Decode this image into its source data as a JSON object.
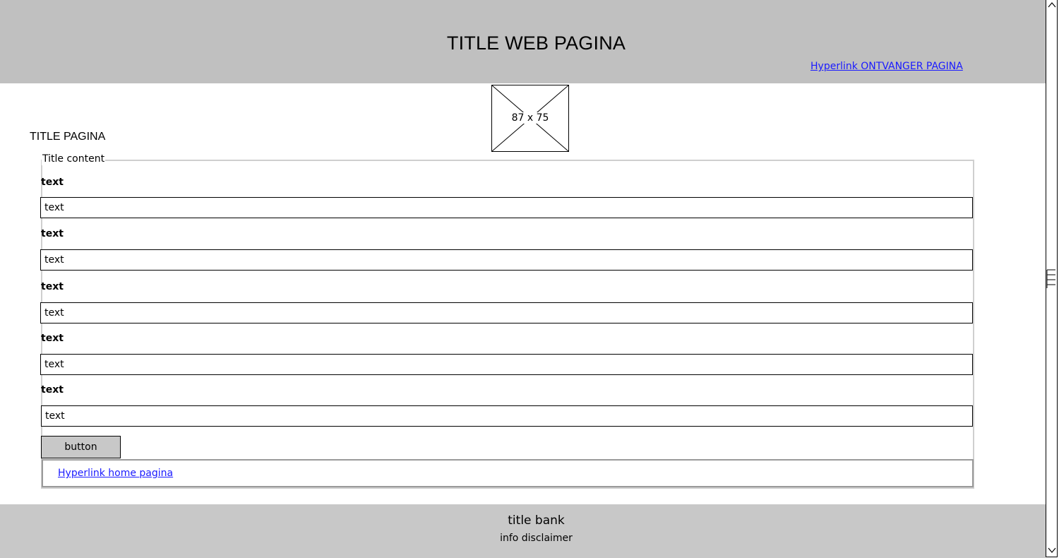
{
  "header": {
    "title": "TITLE WEB PAGINA",
    "link_label": "Hyperlink ONTVANGER PAGINA"
  },
  "image_placeholder": {
    "label": "87 x 75"
  },
  "page": {
    "title": "TITLE PAGINA"
  },
  "form": {
    "legend": "Title content",
    "fields": [
      {
        "label": "text",
        "value": "text"
      },
      {
        "label": "text",
        "value": "text"
      },
      {
        "label": "text",
        "value": "text"
      },
      {
        "label": "text",
        "value": "text"
      },
      {
        "label": "text",
        "value": "text"
      }
    ],
    "button_label": "button",
    "home_link_label": "Hyperlink home pagina"
  },
  "footer": {
    "title": "title bank",
    "info": "info disclaimer"
  },
  "colors": {
    "header_bg": "#c0c0c0",
    "footer_bg": "#c8c8c8",
    "link": "#1a1aff",
    "button_bg": "#c8c8c8"
  },
  "icons": {
    "scroll_up": "chevron-up-icon",
    "scroll_down": "chevron-down-icon",
    "image": "image-placeholder-icon"
  }
}
